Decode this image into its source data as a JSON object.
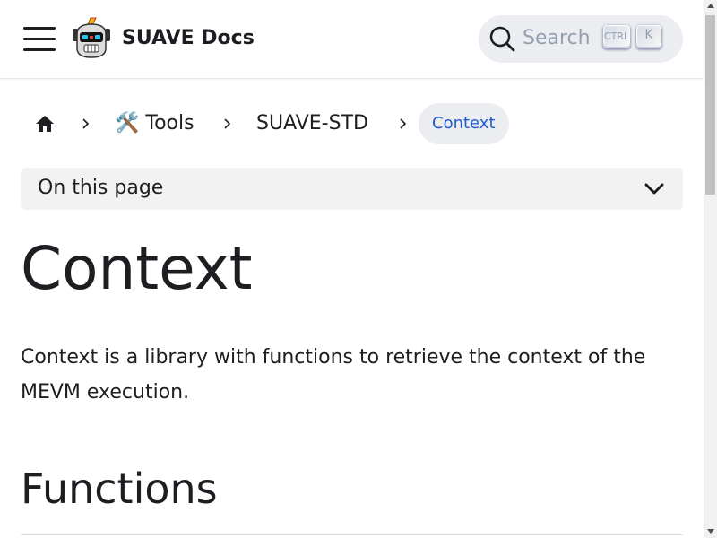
{
  "navbar": {
    "brand": "SUAVE Docs",
    "logo_icon": "robot-logo-icon",
    "menu_icon": "hamburger-menu-icon",
    "search": {
      "placeholder": "Search",
      "shortcut_ctrl": "CTRL",
      "shortcut_key": "K",
      "icon": "search-icon"
    }
  },
  "breadcrumbs": {
    "home_icon": "home-icon",
    "items": [
      {
        "label": "🛠️ Tools"
      },
      {
        "label": "SUAVE-STD"
      }
    ],
    "active": "Context"
  },
  "toc": {
    "label": "On this page",
    "icon": "chevron-down-icon"
  },
  "content": {
    "title": "Context",
    "description": "Context is a library with functions to retrieve the context of the MEVM execution.",
    "section_heading": "Functions"
  },
  "colors": {
    "link_active": "#1c5bd6",
    "search_bg": "#ebedf0",
    "text": "#1c1e21"
  }
}
